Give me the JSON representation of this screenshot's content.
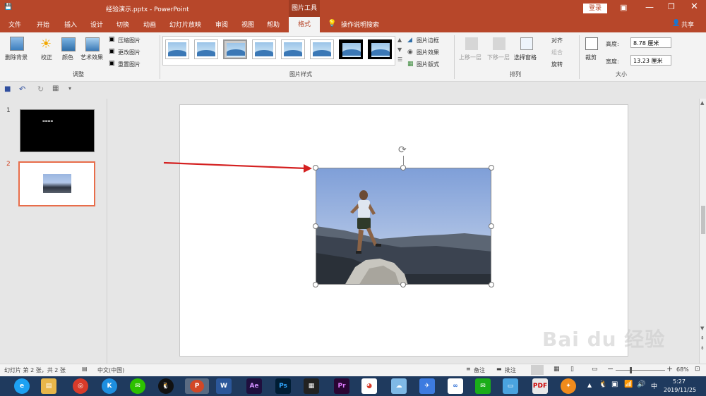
{
  "titlebar": {
    "doc_title": "经验演示.pptx  -  PowerPoint",
    "context_tab": "图片工具",
    "login": "登录",
    "share": "共享"
  },
  "tabs": [
    "文件",
    "开始",
    "插入",
    "设计",
    "切换",
    "动画",
    "幻灯片放映",
    "审阅",
    "视图",
    "帮助"
  ],
  "active_tab": "格式",
  "tell_me": "操作说明搜索",
  "ribbon": {
    "remove_bg": "删除背景",
    "corrections": "校正",
    "color": "颜色",
    "artistic": "艺术效果",
    "compress": "压缩图片",
    "change": "更改图片",
    "reset": "重置图片",
    "adjust_group": "调整",
    "styles_group": "图片样式",
    "border": "图片边框",
    "effects": "图片效果",
    "layout": "图片版式",
    "bring_forward": "上移一层",
    "send_backward": "下移一层",
    "selection_pane": "选择窗格",
    "align": "对齐",
    "group": "组合",
    "rotate": "旋转",
    "arrange_group": "排列",
    "crop": "裁剪",
    "height_label": "高度:",
    "height_value": "8.78 厘米",
    "width_label": "宽度:",
    "width_value": "13.23 厘米",
    "size_group": "大小"
  },
  "slides": [
    {
      "number": "1",
      "text": "▬▬▬▬"
    },
    {
      "number": "2"
    }
  ],
  "status": {
    "slide_info": "幻灯片 第 2 张，共 2 张",
    "language": "中文(中国)",
    "notes": "备注",
    "comments": "批注",
    "zoom": "68%"
  },
  "taskbar": {
    "time": "5:27",
    "date": "2019/11/25"
  },
  "watermark": "Bai du 经验",
  "colors": {
    "accent": "#b7472a",
    "arrow": "#d42020",
    "taskbar": "#1f3a5e"
  }
}
